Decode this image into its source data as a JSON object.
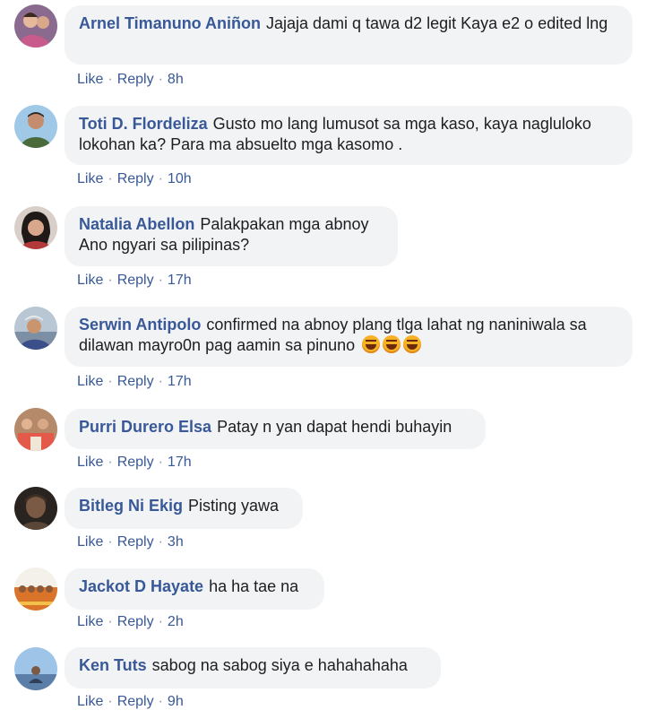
{
  "actions": {
    "like_label": "Like",
    "reply_label": "Reply",
    "separator": "·"
  },
  "comments": [
    {
      "author": "Arnel Timanuno Aniñon",
      "text": "Jajaja dami q tawa d2 legit Kaya e2 o edited lng",
      "time": "8h"
    },
    {
      "author": "Toti D. Flordeliza",
      "text": "Gusto mo lang lumusot sa mga kaso, kaya nagluloko lokohan ka? Para ma absuelto mga kasomo .",
      "time": "10h"
    },
    {
      "author": "Natalia Abellon",
      "text": "Palakpakan mga abnoy",
      "text2": "Ano ngyari sa pilipinas?",
      "time": "17h"
    },
    {
      "author": "Serwin Antipolo",
      "text": "confirmed na abnoy plang tlga lahat ng naniniwala sa dilawan mayro0n pag aamin sa pinuno",
      "emoji": "laughing-tears-emoji",
      "time": "17h"
    },
    {
      "author": "Purri Durero Elsa",
      "text": "Patay n yan dapat hendi buhayin",
      "time": "17h"
    },
    {
      "author": "Bitleg Ni Ekig",
      "text": "Pisting yawa",
      "time": "3h"
    },
    {
      "author": "Jackot D Hayate",
      "text": "ha ha tae na",
      "time": "2h"
    },
    {
      "author": "Ken Tuts",
      "text": "sabog na sabog siya e hahahahaha",
      "time": "9h"
    }
  ]
}
